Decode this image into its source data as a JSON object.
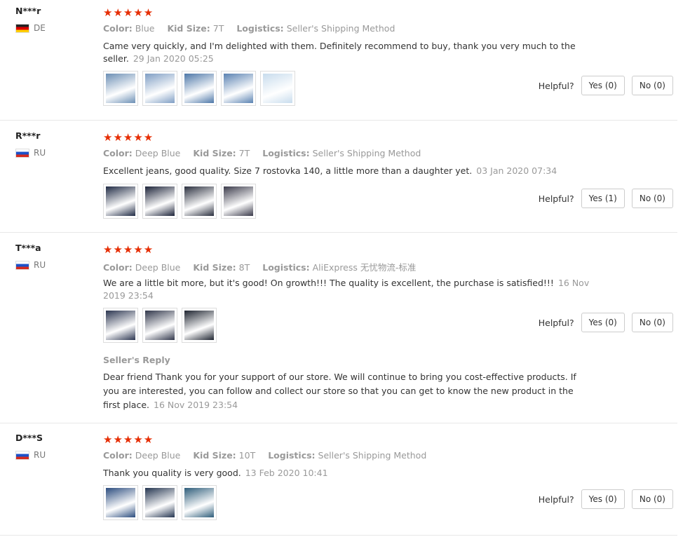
{
  "helpful_label": "Helpful?",
  "labels": {
    "color": "Color:",
    "size": "Kid Size:",
    "logistics": "Logistics:"
  },
  "stars": "★★★★★",
  "reviews": [
    {
      "user": "N***r",
      "country": "DE",
      "color": "Blue",
      "size": "7T",
      "logistics": "Seller's Shipping Method",
      "text": "Came very quickly, and I'm delighted with them. Definitely recommend to buy, thank you very much to the seller.",
      "date": "29 Jan 2020 05:25",
      "yes": "Yes (0)",
      "no": "No (0)",
      "thumb_colors": [
        "#6c8fb5",
        "#7f9ec4",
        "#4d77a8",
        "#5a82b2",
        "#c8dced"
      ]
    },
    {
      "user": "R***r",
      "country": "RU",
      "color": "Deep Blue",
      "size": "7T",
      "logistics": "Seller's Shipping Method",
      "text": "Excellent jeans, good quality. Size 7 rostovka 140, a little more than a daughter yet.",
      "date": "03 Jan 2020 07:34",
      "yes": "Yes (1)",
      "no": "No (0)",
      "thumb_colors": [
        "#1f2a44",
        "#1b2238",
        "#2a2f3e",
        "#3a3a4a"
      ]
    },
    {
      "user": "T***a",
      "country": "RU",
      "color": "Deep Blue",
      "size": "8T",
      "logistics": "AliExpress 无忧物流-标准",
      "text": "We are a little bit more, but it's good! On growth!!! The quality is excellent, the purchase is satisfied!!!",
      "date": "16 Nov 2019 23:54",
      "yes": "Yes (0)",
      "no": "No (0)",
      "thumb_colors": [
        "#2b3550",
        "#30364a",
        "#1e2430"
      ],
      "reply_title": "Seller's Reply",
      "reply_text": "Dear friend Thank you for your support of our store. We will continue to bring you cost-effective products. If you are interested, you can follow and collect our store so that you can get to know the new product in the first place.",
      "reply_date": "16 Nov 2019 23:54"
    },
    {
      "user": "D***S",
      "country": "RU",
      "color": "Deep Blue",
      "size": "10T",
      "logistics": "Seller's Shipping Method",
      "text": "Thank you quality is very good.",
      "date": "13 Feb 2020 10:41",
      "yes": "Yes (0)",
      "no": "No (0)",
      "thumb_colors": [
        "#2b4c7e",
        "#23344f",
        "#2e5d7a"
      ]
    }
  ]
}
